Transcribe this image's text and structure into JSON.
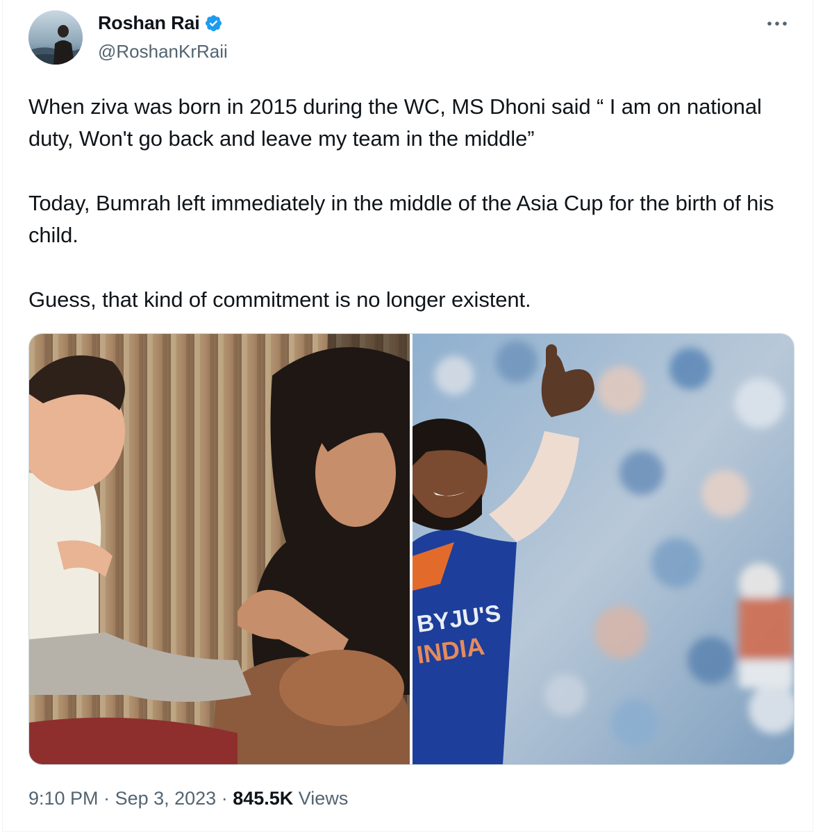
{
  "author": {
    "display_name": "Roshan Rai",
    "handle": "@RoshanKrRaii",
    "verified": true,
    "verified_color": "#1d9bf0"
  },
  "more_icon": "more-horizontal-icon",
  "tweet": {
    "paragraphs": [
      "When ziva was born in 2015 during the WC, MS Dhoni said “ I am on national duty, Won't go back and leave my team in the middle”",
      "Today, Bumrah left immediately in the middle of the Asia Cup for the birth of his child.",
      "Guess, that kind of commitment is no longer existent."
    ]
  },
  "media": {
    "left_photo": "baby-and-parents-photo",
    "right_photo": "cricketer-thumbs-up-photo",
    "jersey_text_1": "BYJU'S",
    "jersey_text_2": "INDIA"
  },
  "meta": {
    "time": "9:10 PM",
    "separator": " · ",
    "date": "Sep 3, 2023",
    "views_count": "845.5K",
    "views_label": " Views"
  }
}
